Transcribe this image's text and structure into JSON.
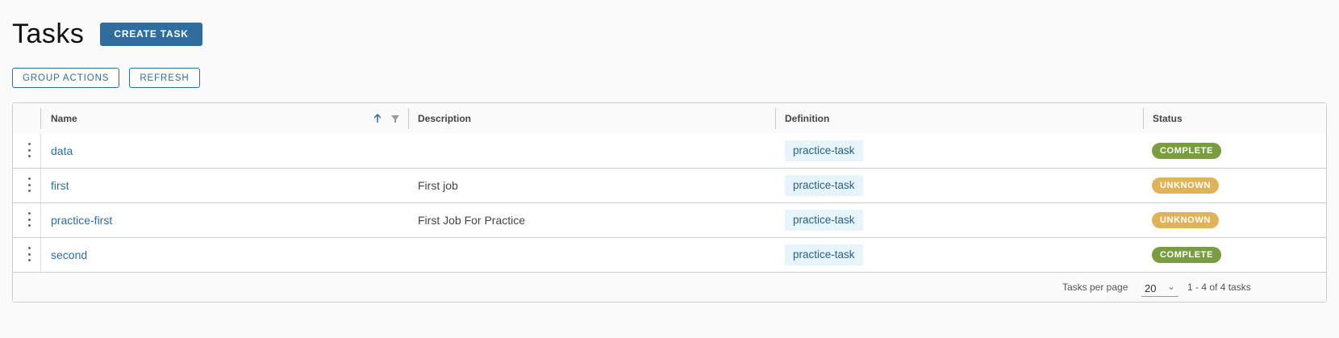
{
  "header": {
    "title": "Tasks",
    "create_label": "CREATE TASK"
  },
  "toolbar": {
    "group_actions_label": "GROUP ACTIONS",
    "refresh_label": "REFRESH"
  },
  "grid": {
    "columns": [
      "Name",
      "Description",
      "Definition",
      "Status"
    ],
    "rows": [
      {
        "name": "data",
        "description": "",
        "definition": "practice-task",
        "status": "COMPLETE"
      },
      {
        "name": "first",
        "description": "First job",
        "definition": "practice-task",
        "status": "UNKNOWN"
      },
      {
        "name": "practice-first",
        "description": "First Job For Practice",
        "definition": "practice-task",
        "status": "UNKNOWN"
      },
      {
        "name": "second",
        "description": "",
        "definition": "practice-task",
        "status": "COMPLETE"
      }
    ],
    "footer": {
      "per_page_label": "Tasks per page",
      "page_size": "20",
      "range_text": "1 - 4 of 4 tasks"
    }
  },
  "colors": {
    "complete": "#7a9e3f",
    "unknown": "#e0b35a",
    "accent": "#2e6d9e"
  }
}
